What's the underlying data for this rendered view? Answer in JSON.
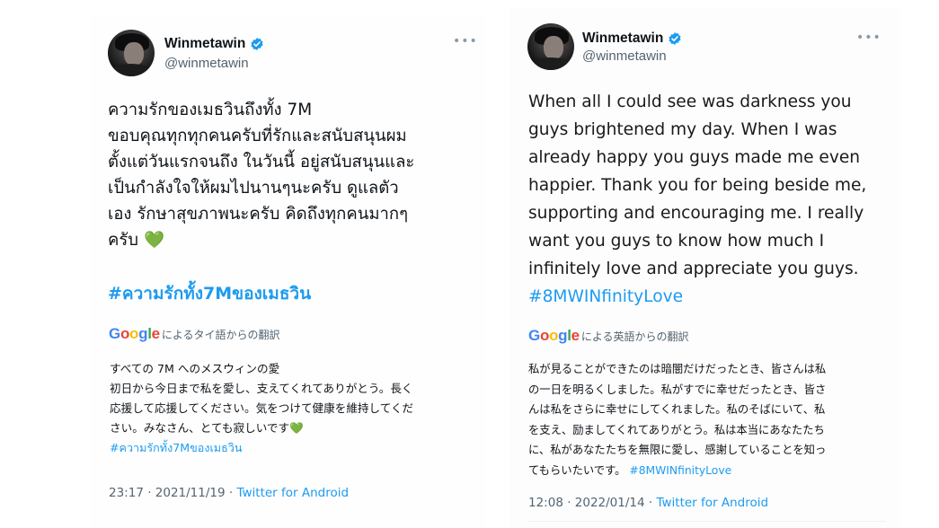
{
  "left_tweet": {
    "display_name": "Winmetawin",
    "handle": "@winmetawin",
    "body_lines": [
      "ความรักของเมธวินถึงทั้ง 7M",
      "ขอบคุณทุกทุกคนครับที่รักและสนับสนุนผม",
      "ตั้งแต่วันแรกจนถึง ในวันนี้ อยู่สนับสนุนและ",
      "เป็นกำลังใจให้ผมไปนานๆนะครับ ดูแลตัว",
      "เอง รักษาสุขภาพนะครับ คิดถึงทุกคนมากๆ",
      "ครับ"
    ],
    "heart_emoji": "💚",
    "hashtag": "#ความรักทั้ง7Mของเมธวิน",
    "translation_label": "によるタイ語からの翻訳",
    "translation_lines": [
      "すべての 7M へのメスウィンの愛",
      "初日から今日まで私を愛し、支えてくれてありがとう。長く",
      "応援して応援してください。気をつけて健康を維持してくだ",
      "さい。みなさん、とても寂しいです"
    ],
    "translation_heart": "💚",
    "translation_hashtag": "#ความรักทั้ง7Mของเมธวิน",
    "time": "23:17 · 2021/11/19 · ",
    "source": "Twitter for Android"
  },
  "right_tweet": {
    "display_name": "Winmetawin",
    "handle": "@winmetawin",
    "body_lines": [
      "When all I could see was darkness you",
      "guys brightened my day. When I was",
      "already happy you guys made me even",
      "happier. Thank you for being beside me,",
      "supporting and encouraging me. I really",
      "want you guys to know how much I",
      "infinitely love and appreciate you guys."
    ],
    "hashtag": "#8MWINfinityLove",
    "translation_label": "による英語からの翻訳",
    "translation_lines": [
      "私が見ることができたのは暗闇だけだったとき、皆さんは私",
      "の一日を明るくしました。私がすでに幸せだったとき、皆さ",
      "んは私をさらに幸せにしてくれました。私のそばにいて、私",
      "を支え、励ましてくれてありがとう。私は本当にあなたたち",
      "に、私があなたたちを無限に愛し、感謝していることを知っ",
      "てもらいたいです。"
    ],
    "translation_hashtag": "#8MWINfinityLove",
    "time": "12:08 · 2022/01/14 · ",
    "source": "Twitter for Android"
  },
  "google_logo": "Google",
  "more_icon": "more-horizontal-icon",
  "colors": {
    "link": "#1d9bf0",
    "verified": "#1d9bf0",
    "muted": "#536471",
    "text": "#0f1419"
  }
}
